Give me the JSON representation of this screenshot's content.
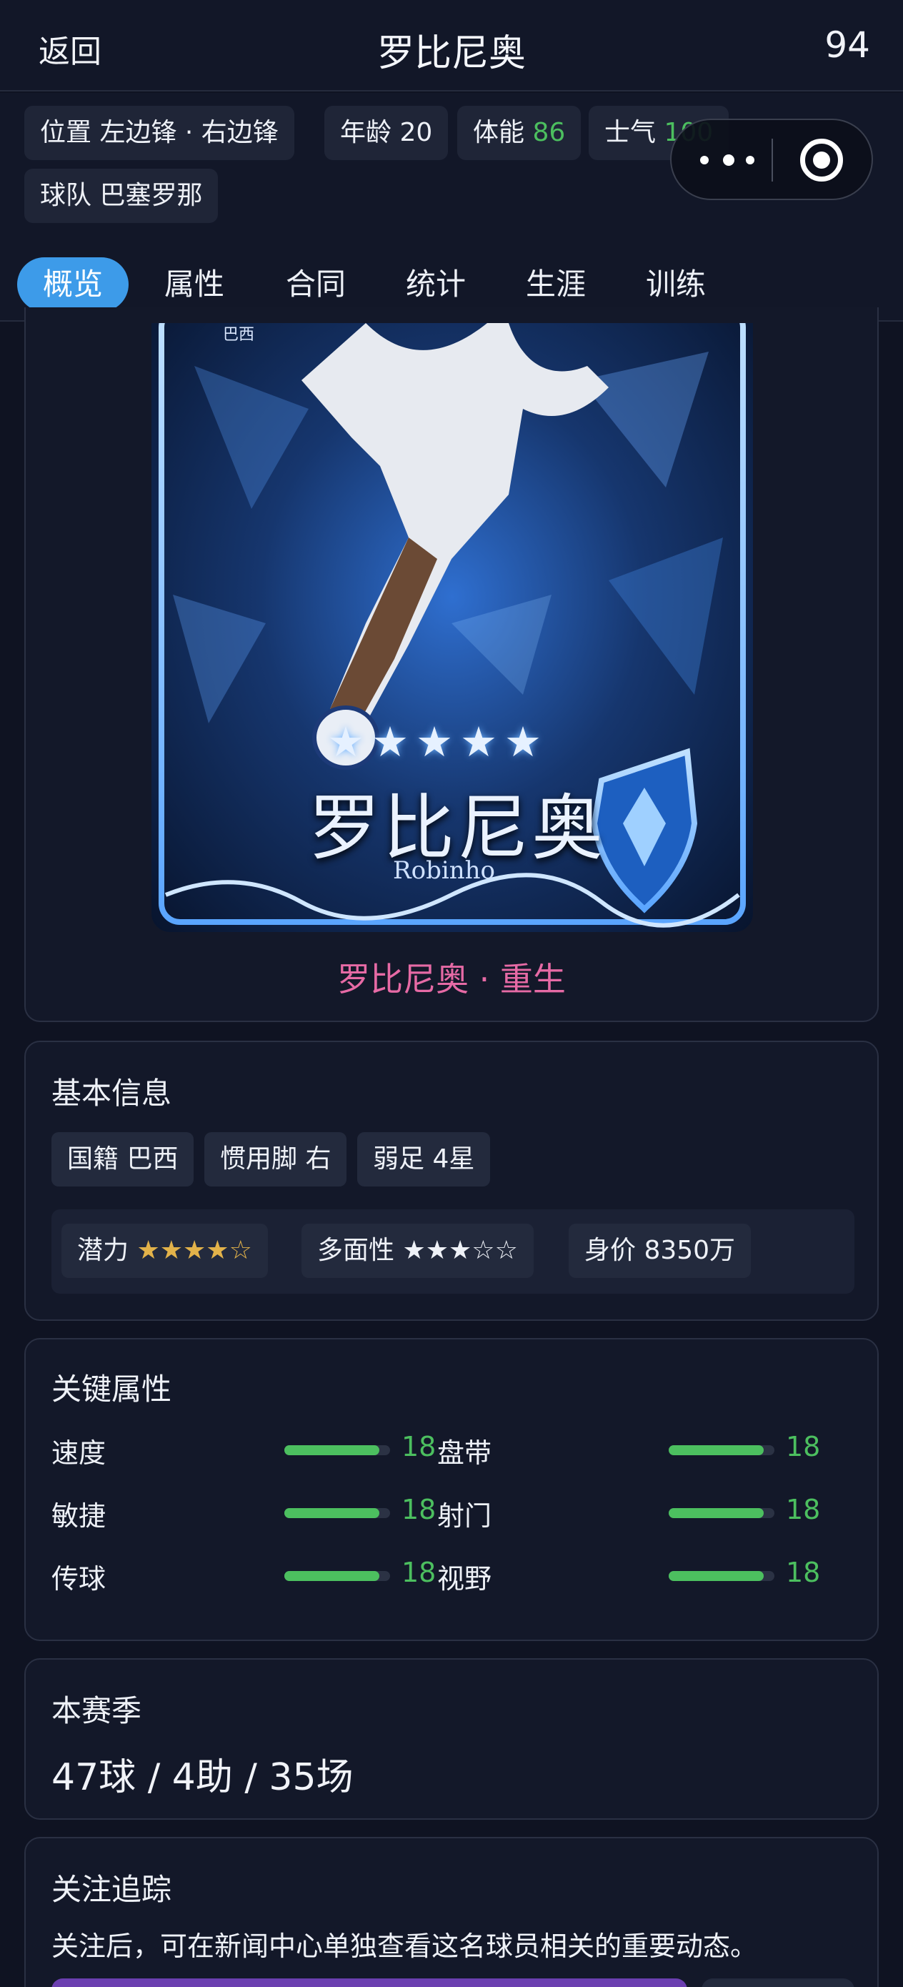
{
  "nav": {
    "back_label": "返回",
    "title": "罗比尼奥",
    "overall": "94"
  },
  "info": {
    "position_label": "位置",
    "position_value": "左边锋 · 右边锋",
    "age_label": "年龄",
    "age_value": "20",
    "stamina_label": "体能",
    "stamina_value": "86",
    "morale_label": "士气",
    "morale_value": "100",
    "team_label": "球队",
    "team_value": "巴塞罗那"
  },
  "tabs": [
    "概览",
    "属性",
    "合同",
    "统计",
    "生涯",
    "训练"
  ],
  "active_tab": 0,
  "player_card": {
    "nationality_tag": "巴西",
    "card_stars": "★★★★★",
    "card_name": "罗比尼奥",
    "card_name_en": "Robinho",
    "caption": "罗比尼奥 · 重生"
  },
  "basic_info": {
    "title": "基本信息",
    "nationality": "国籍 巴西",
    "foot": "惯用脚 右",
    "weak_foot": "弱足 4星",
    "potential_label": "潜力",
    "potential_stars": "★★★★☆",
    "versatility_label": "多面性",
    "versatility_stars": "★★★☆☆",
    "value_label": "身价 8350万"
  },
  "key_attributes": {
    "title": "关键属性",
    "items": [
      {
        "name": "速度",
        "value": "18",
        "fill": 0.9
      },
      {
        "name": "盘带",
        "value": "18",
        "fill": 0.9
      },
      {
        "name": "敏捷",
        "value": "18",
        "fill": 0.9
      },
      {
        "name": "射门",
        "value": "18",
        "fill": 0.9
      },
      {
        "name": "传球",
        "value": "18",
        "fill": 0.9
      },
      {
        "name": "视野",
        "value": "18",
        "fill": 0.9
      }
    ]
  },
  "season": {
    "title": "本赛季",
    "summary": "47球 / 4助 / 35场"
  },
  "follow": {
    "title": "关注追踪",
    "desc": "关注后，可在新闻中心单独查看这名球员相关的重要动态。"
  },
  "colors": {
    "accent_tab": "#3d9be9",
    "green": "#4cbf5f",
    "caption_pink": "#e66aa5",
    "gold": "#e2b24a"
  }
}
